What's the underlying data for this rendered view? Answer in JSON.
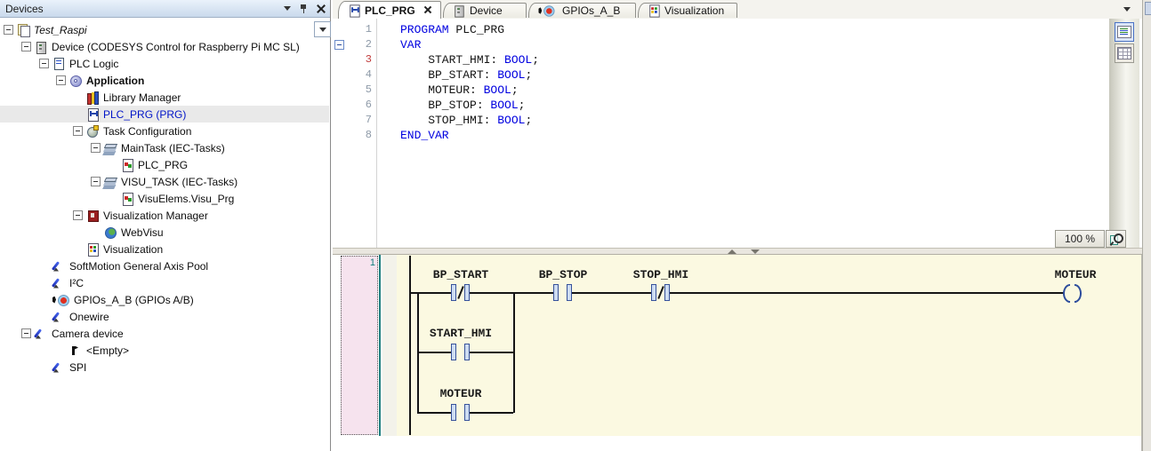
{
  "devices_panel": {
    "title": "Devices",
    "tree": [
      {
        "label": "Test_Raspi"
      },
      {
        "label": "Device (CODESYS Control for Raspberry Pi MC SL)"
      },
      {
        "label": "PLC Logic"
      },
      {
        "label": "Application"
      },
      {
        "label": "Library Manager"
      },
      {
        "label": "PLC_PRG (PRG)"
      },
      {
        "label": "Task Configuration"
      },
      {
        "label": "MainTask (IEC-Tasks)"
      },
      {
        "label": "PLC_PRG"
      },
      {
        "label": "VISU_TASK (IEC-Tasks)"
      },
      {
        "label": "VisuElems.Visu_Prg"
      },
      {
        "label": "Visualization Manager"
      },
      {
        "label": "WebVisu"
      },
      {
        "label": "Visualization"
      },
      {
        "label": "SoftMotion General Axis Pool"
      },
      {
        "label": "I²C"
      },
      {
        "label": "GPIOs_A_B (GPIOs A/B)"
      },
      {
        "label": "Onewire"
      },
      {
        "label": "Camera device"
      },
      {
        "label": "<Empty>"
      },
      {
        "label": "SPI"
      }
    ]
  },
  "tab_bar": {
    "tabs": [
      {
        "label": "PLC_PRG"
      },
      {
        "label": "Device"
      },
      {
        "label": "GPIOs_A_B"
      },
      {
        "label": "Visualization"
      }
    ]
  },
  "code_editor": {
    "lines": [
      {
        "num": "1",
        "p1": "",
        "k": "PROGRAM",
        "p2": " PLC_PRG"
      },
      {
        "num": "2",
        "p1": "",
        "k": "VAR",
        "p2": ""
      },
      {
        "num": "3",
        "p1": "    START_HMI: ",
        "k": "BOOL",
        "p2": ";"
      },
      {
        "num": "4",
        "p1": "    BP_START: ",
        "k": "BOOL",
        "p2": ";"
      },
      {
        "num": "5",
        "p1": "    MOTEUR: ",
        "k": "BOOL",
        "p2": ";"
      },
      {
        "num": "6",
        "p1": "    BP_STOP: ",
        "k": "BOOL",
        "p2": ";"
      },
      {
        "num": "7",
        "p1": "    STOP_HMI: ",
        "k": "BOOL",
        "p2": ";"
      },
      {
        "num": "8",
        "p1": "",
        "k": "END_VAR",
        "p2": ""
      }
    ],
    "zoom_level": "100 %"
  },
  "ladder_editor": {
    "network_number": "1",
    "rung_contacts": [
      {
        "name": "BP_START",
        "type": "NC"
      },
      {
        "name": "BP_STOP",
        "type": "NO"
      },
      {
        "name": "STOP_HMI",
        "type": "NC"
      }
    ],
    "branch_contacts": [
      {
        "name": "START_HMI",
        "type": "NO"
      },
      {
        "name": "MOTEUR",
        "type": "NO"
      }
    ],
    "coil": {
      "name": "MOTEUR"
    }
  },
  "colors": {
    "keyword": "#0000e0",
    "selected_item_text": "#0014c8",
    "network_background": "#fbf9e1",
    "network_margin": "#f6e3ee",
    "contact_symbol": "#37529b"
  }
}
